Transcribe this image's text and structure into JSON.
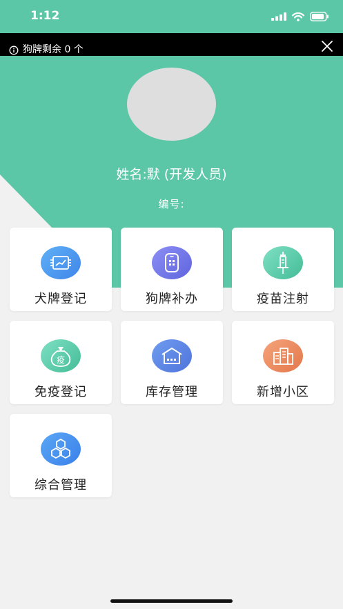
{
  "status_bar": {
    "time": "1:12"
  },
  "notice": {
    "text": "狗牌剩余 0 个",
    "info_icon": "info-circle-icon",
    "close_icon": "close-icon"
  },
  "profile": {
    "name": "姓名:默 (开发人员)",
    "id_label": "编号:"
  },
  "colors": {
    "brand_green": "#5cc7a7",
    "page_bg": "#f1f1f1"
  },
  "menu": {
    "items": [
      {
        "label": "犬牌登记",
        "icon": "registration-card-icon",
        "color_from": "#5fb0f6",
        "color_to": "#3f86ea"
      },
      {
        "label": "狗牌补办",
        "icon": "tag-device-icon",
        "color_from": "#8d8ff5",
        "color_to": "#5e64dd"
      },
      {
        "label": "疫苗注射",
        "icon": "syringe-icon",
        "color_from": "#7fe0c3",
        "color_to": "#44bc97"
      },
      {
        "label": "免疫登记",
        "icon": "immunization-bag-icon",
        "color_from": "#7fe0c3",
        "color_to": "#44bc97"
      },
      {
        "label": "库存管理",
        "icon": "warehouse-icon",
        "color_from": "#6f9cf0",
        "color_to": "#4f74db"
      },
      {
        "label": "新增小区",
        "icon": "building-icon",
        "color_from": "#f5a47c",
        "color_to": "#e3774a"
      },
      {
        "label": "综合管理",
        "icon": "hexagons-icon",
        "color_from": "#5aa7f5",
        "color_to": "#3a80ea"
      }
    ]
  }
}
